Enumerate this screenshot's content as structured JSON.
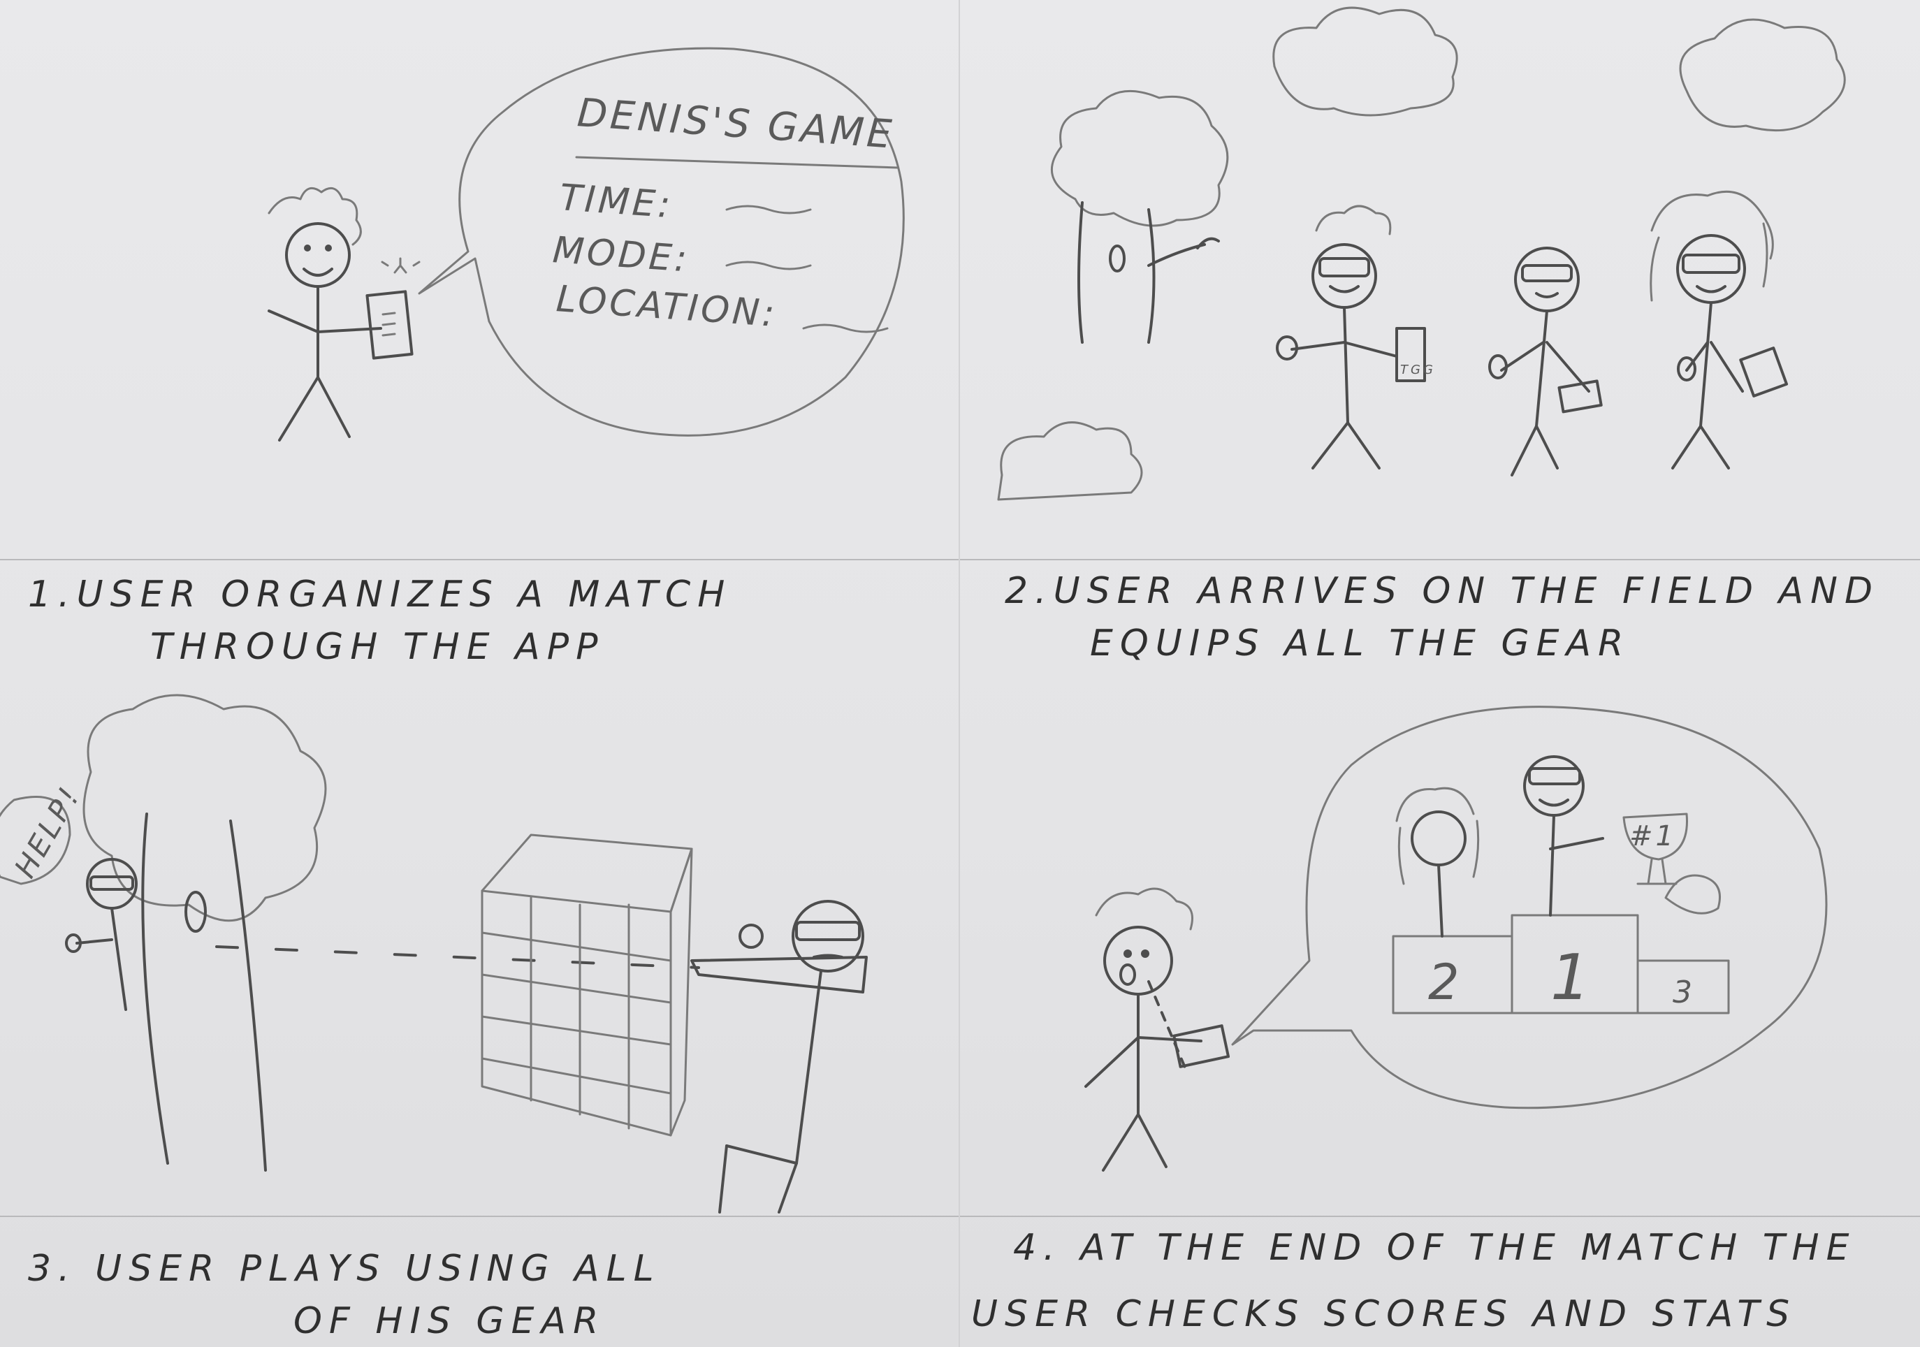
{
  "panels": [
    {
      "caption_line1": "1.USER ORGANIZES A MATCH",
      "caption_line2": "THROUGH THE APP",
      "bubble": {
        "title": "DENIS'S GAME",
        "time_label": "TIME:",
        "mode_label": "MODE:",
        "location_label": "LOCATION:"
      }
    },
    {
      "caption_line1": "2.USER ARRIVES ON THE FIELD AND",
      "caption_line2": "EQUIPS ALL THE GEAR",
      "device_label": "TGG"
    },
    {
      "caption_line1": "3. USER PLAYS USING ALL",
      "caption_line2": "OF HIS GEAR",
      "help_text": "HELP!"
    },
    {
      "caption_line1": "4. AT THE END OF THE MATCH THE",
      "caption_line2": "USER CHECKS SCORES AND STATS",
      "trophy_text": "#1",
      "podium": [
        "2",
        "1",
        "3"
      ]
    }
  ],
  "colors": {
    "paper": "#e6e6e8",
    "ink": "#4d4d4d"
  }
}
